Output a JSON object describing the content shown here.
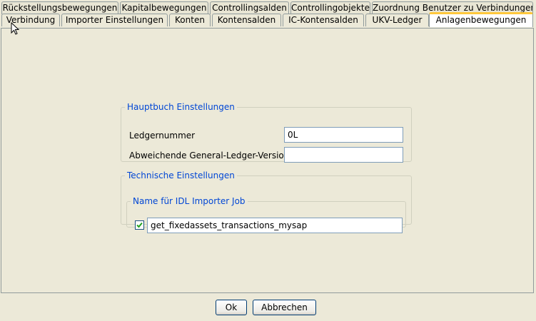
{
  "tabs_back": [
    {
      "label": "Rückstellungsbewegungen"
    },
    {
      "label": "Kapitalbewegungen"
    },
    {
      "label": "Controllingsalden"
    },
    {
      "label": "Controllingobjekte"
    },
    {
      "label": "Zuordnung Benutzer zu Verbindungen"
    }
  ],
  "tabs_front": [
    {
      "label": "Verbindung"
    },
    {
      "label": "Importer Einstellungen"
    },
    {
      "label": "Konten"
    },
    {
      "label": "Kontensalden"
    },
    {
      "label": "IC-Kontensalden"
    },
    {
      "label": "UKV-Ledger"
    },
    {
      "label": "Anlagenbewegungen",
      "selected": true
    }
  ],
  "hauptbuch": {
    "title": "Hauptbuch Einstellungen",
    "ledgernummer_label": "Ledgernummer",
    "ledgernummer_value": "0L",
    "abweichende_label": "Abweichende General-Ledger-Version",
    "abweichende_value": ""
  },
  "technische": {
    "title": "Technische Einstellungen",
    "job_group_title": "Name für IDL Importer Job",
    "job_enabled": true,
    "job_value": "get_fixedassets_transactions_mysap"
  },
  "footer": {
    "ok_label": "Ok",
    "cancel_label": "Abbrechen"
  }
}
